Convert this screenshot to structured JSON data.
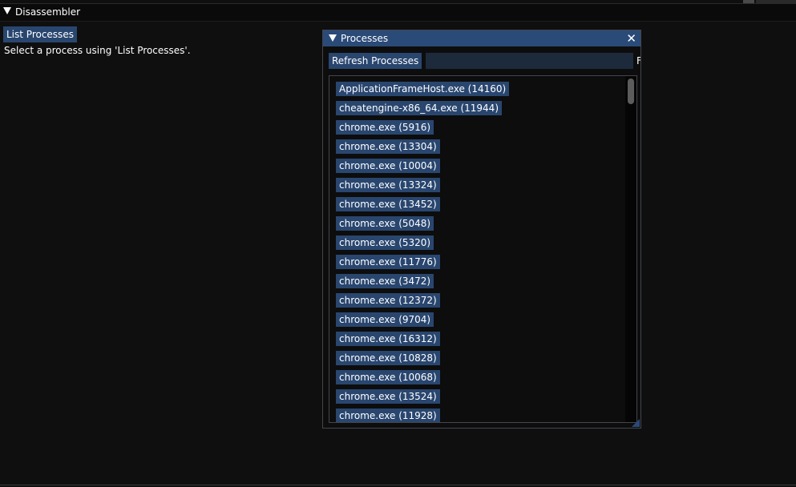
{
  "main_window": {
    "title": "Disassembler",
    "list_processes_label": "List Processes",
    "hint_text": "Select a process using 'List Processes'."
  },
  "processes_window": {
    "title": "Processes",
    "close_glyph": "✕",
    "refresh_label": "Refresh Processes",
    "filter_value": "",
    "filter_label_glyph": "F",
    "items": [
      "ApplicationFrameHost.exe (14160)",
      "cheatengine-x86_64.exe (11944)",
      "chrome.exe (5916)",
      "chrome.exe (13304)",
      "chrome.exe (10004)",
      "chrome.exe (13324)",
      "chrome.exe (13452)",
      "chrome.exe (5048)",
      "chrome.exe (5320)",
      "chrome.exe (11776)",
      "chrome.exe (3472)",
      "chrome.exe (12372)",
      "chrome.exe (9704)",
      "chrome.exe (16312)",
      "chrome.exe (10828)",
      "chrome.exe (10068)",
      "chrome.exe (13524)",
      "chrome.exe (11928)"
    ]
  },
  "colors": {
    "background": "#0f0f0f",
    "button": "#29466f",
    "title_bar_active": "#2a4a78",
    "text": "#ffffff"
  }
}
